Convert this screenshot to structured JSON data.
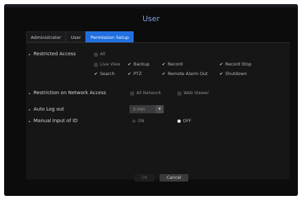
{
  "dialog": {
    "title": "User"
  },
  "tabs": [
    {
      "label": "Administrator",
      "active": false
    },
    {
      "label": "User",
      "active": false
    },
    {
      "label": "Permission Setup",
      "active": true
    }
  ],
  "restricted_access": {
    "label": "Restricted Access",
    "all": {
      "label": "All",
      "checked": false
    },
    "options": [
      {
        "label": "Live View",
        "checked": false
      },
      {
        "label": "Backup",
        "checked": true
      },
      {
        "label": "Record",
        "checked": true
      },
      {
        "label": "Record Stop",
        "checked": true
      },
      {
        "label": "Search",
        "checked": true
      },
      {
        "label": "PTZ",
        "checked": true
      },
      {
        "label": "Remote Alarm Out",
        "checked": true
      },
      {
        "label": "Shutdown",
        "checked": true
      }
    ]
  },
  "network_access": {
    "label": "Restriction on Network Access",
    "options": [
      {
        "label": "All Network",
        "checked": false
      },
      {
        "label": "Web Viewer",
        "checked": false
      }
    ]
  },
  "auto_logout": {
    "label": "Auto Log out",
    "value": "3 min"
  },
  "manual_id": {
    "label": "Manual Input of ID",
    "on_label": "ON",
    "off_label": "OFF",
    "selected": "OFF"
  },
  "footer": {
    "ok_label": "OK",
    "cancel_label": "Cancel"
  },
  "colors": {
    "accent": "#1f6fe0",
    "title": "#7fa8e6",
    "background": "#0c0c0d"
  }
}
